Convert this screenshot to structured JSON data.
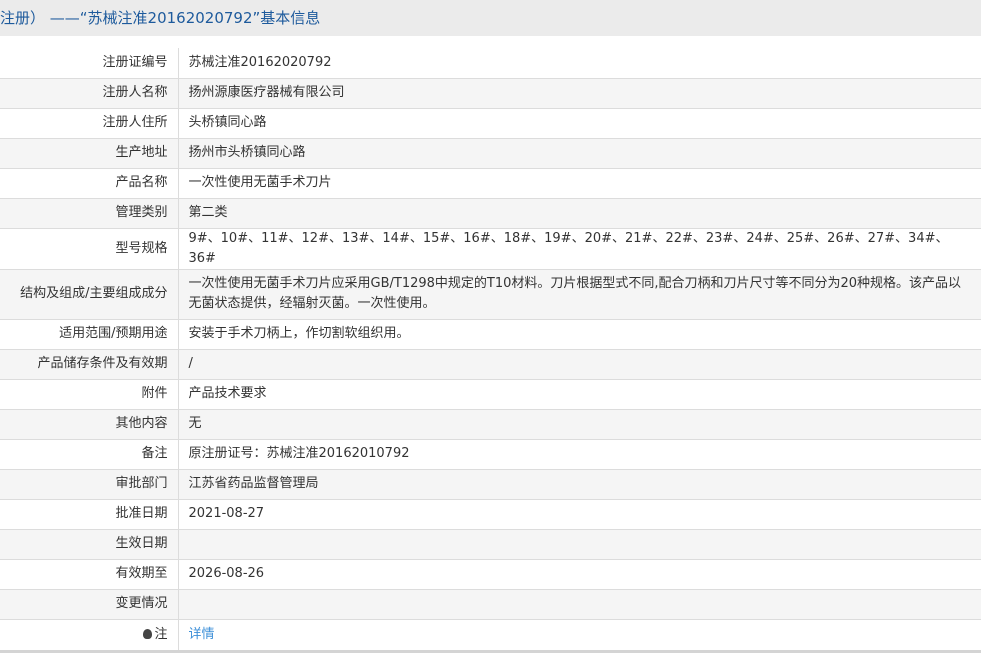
{
  "header": {
    "title": "注册） ——“苏械注准20162020792”基本信息"
  },
  "rows": [
    {
      "label": "注册证编号",
      "value": "苏械注准20162020792"
    },
    {
      "label": "注册人名称",
      "value": "扬州源康医疗器械有限公司"
    },
    {
      "label": "注册人住所",
      "value": "头桥镇同心路"
    },
    {
      "label": "生产地址",
      "value": "扬州市头桥镇同心路"
    },
    {
      "label": "产品名称",
      "value": "一次性使用无菌手术刀片"
    },
    {
      "label": "管理类别",
      "value": "第二类"
    },
    {
      "label": "型号规格",
      "value": "9#、10#、11#、12#、13#、14#、15#、16#、18#、19#、20#、21#、22#、23#、24#、25#、26#、27#、34#、36#"
    },
    {
      "label": "结构及组成/主要组成成分",
      "value": "一次性使用无菌手术刀片应采用GB/T1298中规定的T10材料。刀片根据型式不同,配合刀柄和刀片尺寸等不同分为20种规格。该产品以无菌状态提供，经辐射灭菌。一次性使用。"
    },
    {
      "label": "适用范围/预期用途",
      "value": "安装于手术刀柄上，作切割软组织用。"
    },
    {
      "label": "产品储存条件及有效期",
      "value": "/"
    },
    {
      "label": "附件",
      "value": "产品技术要求"
    },
    {
      "label": "其他内容",
      "value": "无"
    },
    {
      "label": "备注",
      "value": "原注册证号：苏械注准20162010792"
    },
    {
      "label": "审批部门",
      "value": "江苏省药品监督管理局"
    },
    {
      "label": "批准日期",
      "value": "2021-08-27"
    },
    {
      "label": "生效日期",
      "value": ""
    },
    {
      "label": "有效期至",
      "value": "2026-08-26"
    },
    {
      "label": "变更情况",
      "value": ""
    }
  ],
  "note": {
    "label": "注",
    "link": "详情",
    "icon": "lightbulb-icon"
  }
}
